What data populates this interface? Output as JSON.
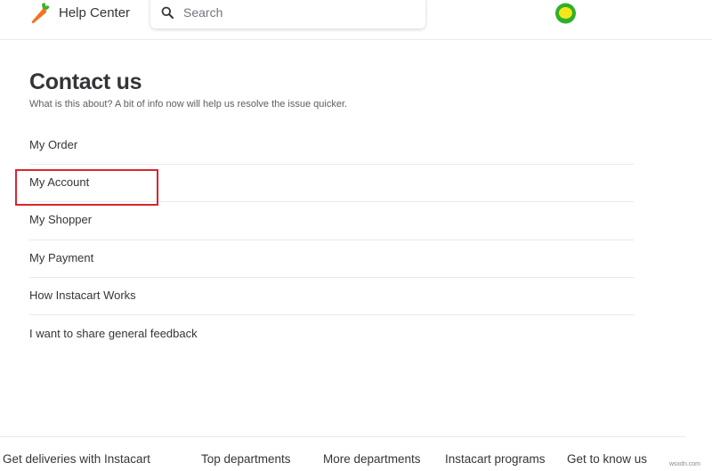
{
  "header": {
    "brand": "Help Center",
    "search_placeholder": "Search"
  },
  "main": {
    "title": "Contact us",
    "subtitle": "What is this about? A bit of info now will help us resolve the issue quicker.",
    "topics": [
      {
        "label": "My Order"
      },
      {
        "label": "My Account"
      },
      {
        "label": "My Shopper"
      },
      {
        "label": "My Payment"
      },
      {
        "label": "How Instacart Works"
      },
      {
        "label": "I want to share general feedback"
      }
    ]
  },
  "footer": {
    "links": [
      {
        "label": "Get deliveries with Instacart"
      },
      {
        "label": "Top departments"
      },
      {
        "label": "More departments"
      },
      {
        "label": "Instacart programs"
      },
      {
        "label": "Get to know us"
      }
    ]
  },
  "watermark": "wsxdn.com",
  "colors": {
    "carrot_orange": "#f37321",
    "carrot_leaf": "#43b02a",
    "highlight_red": "#d9262d",
    "avatar_green": "#2fb02a",
    "avatar_yellow": "#f5e61c"
  }
}
